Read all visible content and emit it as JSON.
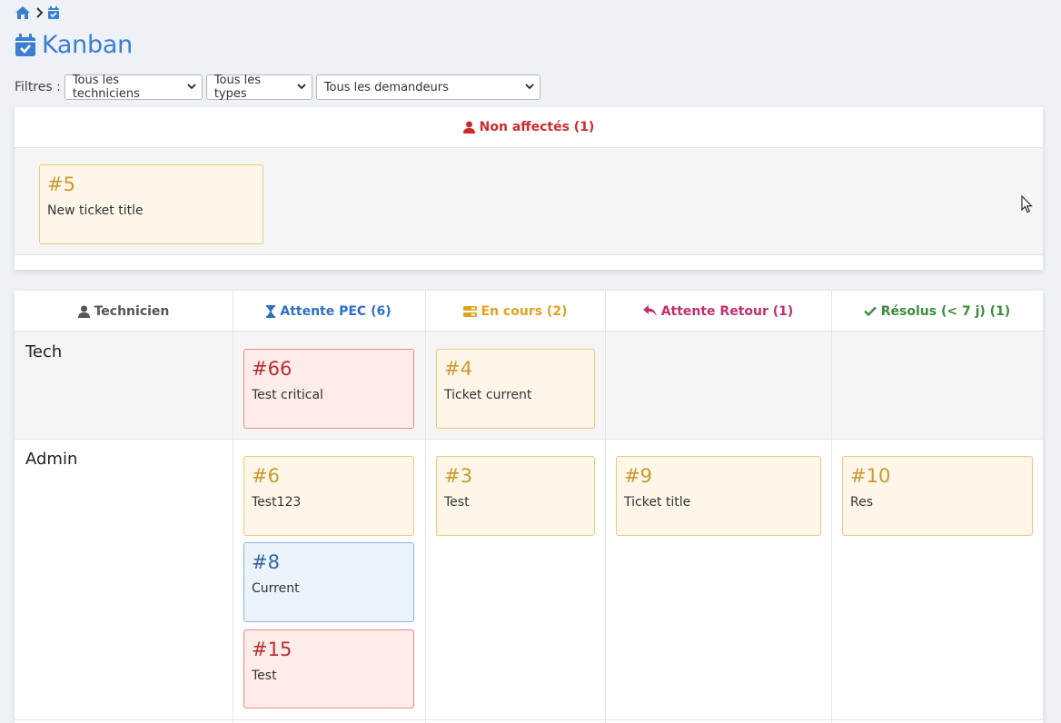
{
  "colors": {
    "accent": "#3b7fd0",
    "unassigned": "#cc2b2b",
    "technician": "#555555",
    "waiting": "#2f6fc4",
    "in_progress": "#e0a21c",
    "awaiting_reply": "#c03070",
    "resolved": "#3e8a3e"
  },
  "breadcrumb": {
    "icons": [
      "home-icon",
      "chevron-right-icon",
      "calendar-check-icon"
    ]
  },
  "page": {
    "title": "Kanban"
  },
  "filters": {
    "label": "Filtres :",
    "technicians": "Tous les techniciens",
    "types": "Tous les types",
    "requesters": "Tous les demandeurs"
  },
  "unassigned": {
    "label": "Non affectés (1)",
    "cards": [
      {
        "number": "#5",
        "title": "New ticket title"
      }
    ]
  },
  "board": {
    "columns": [
      {
        "label": "Technicien",
        "icon": "user-icon"
      },
      {
        "label": "Attente PEC (6)",
        "icon": "hourglass-icon"
      },
      {
        "label": "En cours (2)",
        "icon": "tasks-icon"
      },
      {
        "label": "Attente Retour (1)",
        "icon": "reply-icon"
      },
      {
        "label": "Résolus (< 7 j) (1)",
        "icon": "check-icon"
      }
    ],
    "rows": [
      {
        "name": "Tech",
        "cards": [
          {
            "number": "#66",
            "title": "Test critical"
          },
          {
            "number": "#4",
            "title": "Ticket current"
          }
        ]
      },
      {
        "name": "Admin",
        "cards": [
          {
            "number": "#6",
            "title": "Test123"
          },
          {
            "number": "#8",
            "title": "Current"
          },
          {
            "number": "#15",
            "title": "Test"
          },
          {
            "number": "#3",
            "title": "Test"
          },
          {
            "number": "#9",
            "title": "Ticket title"
          },
          {
            "number": "#10",
            "title": "Res"
          }
        ]
      }
    ]
  }
}
